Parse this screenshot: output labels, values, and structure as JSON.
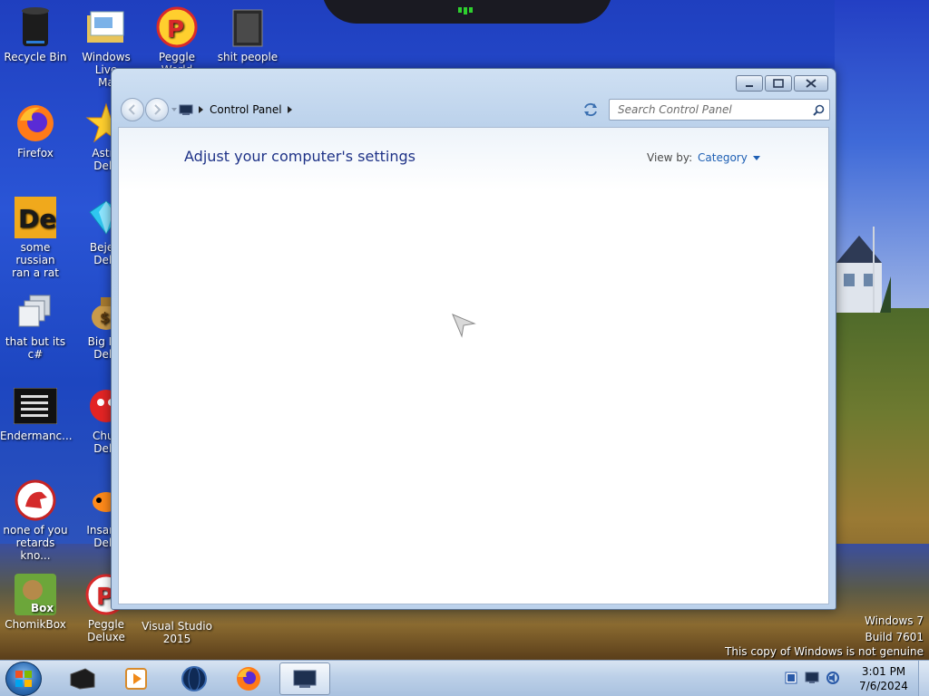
{
  "desktop": {
    "icons": [
      {
        "label": "Recycle Bin",
        "icon": "recycle-bin-icon"
      },
      {
        "label": "Windows Live\nMa",
        "icon": "mail-icon"
      },
      {
        "label": "Peggle World",
        "icon": "peggle-icon"
      },
      {
        "label": "shit people",
        "icon": "folder-icon"
      },
      {
        "label": "Firefox",
        "icon": "firefox-icon"
      },
      {
        "label": "Astro\nDelu",
        "icon": "star-icon"
      },
      {
        "label": "some russian\nran a rat",
        "icon": "de-icon"
      },
      {
        "label": "Bejew\nDelu",
        "icon": "gem-icon"
      },
      {
        "label": "that but its c#",
        "icon": "windows-stack-icon"
      },
      {
        "label": "Big Mo\nDelu",
        "icon": "money-bag-icon"
      },
      {
        "label": "Endermanc...",
        "icon": "terminal-icon"
      },
      {
        "label": "Chuz\nDelu",
        "icon": "chuzzle-icon"
      },
      {
        "label": "none of you\nretards kno...",
        "icon": "dino-icon"
      },
      {
        "label": "Insaniq\nDelu",
        "icon": "fish-icon"
      },
      {
        "label": "ChomikBox",
        "icon": "chomikbox-icon"
      },
      {
        "label": "Peggle Deluxe",
        "icon": "peggle-deluxe-icon"
      },
      {
        "label": "Visual Studio\n2015",
        "icon": "visual-studio-icon"
      }
    ]
  },
  "window": {
    "breadcrumb": "Control Panel",
    "search_placeholder": "Search Control Panel",
    "heading": "Adjust your computer's settings",
    "view_by_label": "View by:",
    "view_by_value": "Category"
  },
  "watermark": {
    "line1": "Windows 7",
    "line2": "Build 7601",
    "line3": "This copy of Windows is not genuine"
  },
  "taskbar": {
    "time": "3:01 PM",
    "date": "7/6/2024"
  },
  "colors": {
    "heading": "#1e3287",
    "link": "#1e5fb4"
  }
}
